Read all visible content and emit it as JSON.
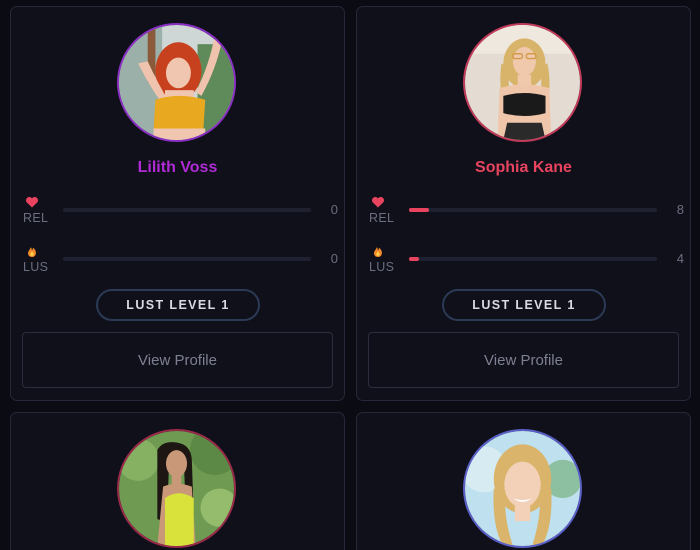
{
  "cards": [
    {
      "name": "Lilith Voss",
      "name_color": "#b02ad6",
      "avatar_border": "#8a2fc4",
      "stats": [
        {
          "label": "REL",
          "icon": "heart-icon",
          "value": "0",
          "fraction": 0
        },
        {
          "label": "LUS",
          "icon": "flame-icon",
          "value": "0",
          "fraction": 0
        }
      ],
      "lust_label": "LUST LEVEL 1",
      "button_label": "View Profile"
    },
    {
      "name": "Sophia Kane",
      "name_color": "#e8445f",
      "avatar_border": "#c23a5a",
      "stats": [
        {
          "label": "REL",
          "icon": "heart-icon",
          "value": "8",
          "fraction": 0.08
        },
        {
          "label": "LUS",
          "icon": "flame-icon",
          "value": "4",
          "fraction": 0.04
        }
      ],
      "lust_label": "LUST LEVEL 1",
      "button_label": "View Profile"
    },
    {
      "name": "",
      "avatar_border": "#9a2a4a"
    },
    {
      "name": "",
      "avatar_border": "#5a5fc8"
    }
  ],
  "colors": {
    "background": "#0b0b14",
    "card": "#0f1019",
    "bar_fill": "#e8445f",
    "heart": "#e8445f",
    "flame": "#f08a2a"
  }
}
